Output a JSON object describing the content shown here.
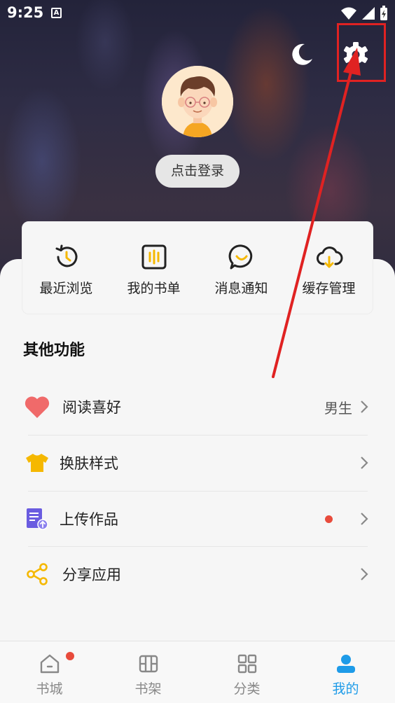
{
  "status_bar": {
    "time": "9:25",
    "a_badge": "A"
  },
  "header": {
    "login_label": "点击登录"
  },
  "quick_actions": [
    {
      "label": "最近浏览",
      "icon": "history-clock-icon"
    },
    {
      "label": "我的书单",
      "icon": "booklist-icon"
    },
    {
      "label": "消息通知",
      "icon": "message-bubble-icon"
    },
    {
      "label": "缓存管理",
      "icon": "cloud-download-icon"
    }
  ],
  "other_features": {
    "title": "其他功能",
    "items": [
      {
        "label": "阅读喜好",
        "value": "男生",
        "icon": "heart-icon"
      },
      {
        "label": "换肤样式",
        "value": "",
        "icon": "tshirt-icon"
      },
      {
        "label": "上传作品",
        "value": "",
        "icon": "upload-document-icon",
        "badge": true
      },
      {
        "label": "分享应用",
        "value": "",
        "icon": "share-icon"
      }
    ]
  },
  "tabbar": [
    {
      "label": "书城",
      "icon": "home-icon",
      "badge": true
    },
    {
      "label": "书架",
      "icon": "bookshelf-icon"
    },
    {
      "label": "分类",
      "icon": "category-grid-icon"
    },
    {
      "label": "我的",
      "icon": "person-icon",
      "active": true
    }
  ],
  "colors": {
    "accent": "#1e9be8",
    "badge": "#e84b3c",
    "annotation": "#e02222",
    "heart": "#f06a6a",
    "tshirt": "#f5b800",
    "upload": "#6a5ce0",
    "share": "#f5b800"
  }
}
